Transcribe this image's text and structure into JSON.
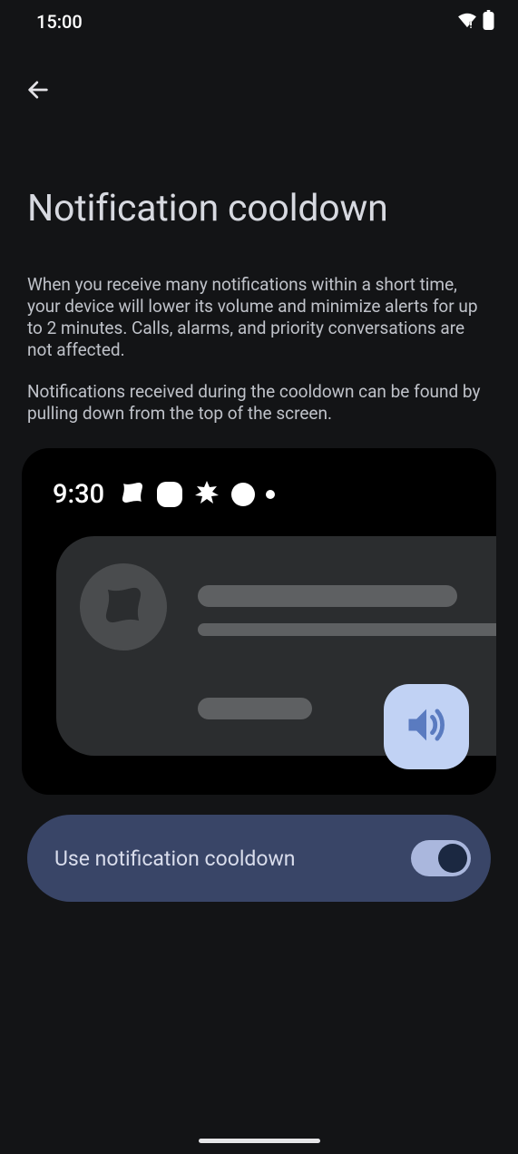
{
  "status": {
    "time": "15:00"
  },
  "page": {
    "title": "Notification cooldown",
    "description1": "When you receive many notifications within a short time, your device will lower its volume and minimize alerts for up to 2 minutes. Calls, alarms, and priority conversations are not affected.",
    "description2": "Notifications received during the cooldown can be found by pulling down from the top of the screen."
  },
  "illustration": {
    "time": "9:30"
  },
  "toggle": {
    "label": "Use notification cooldown",
    "enabled": true
  }
}
